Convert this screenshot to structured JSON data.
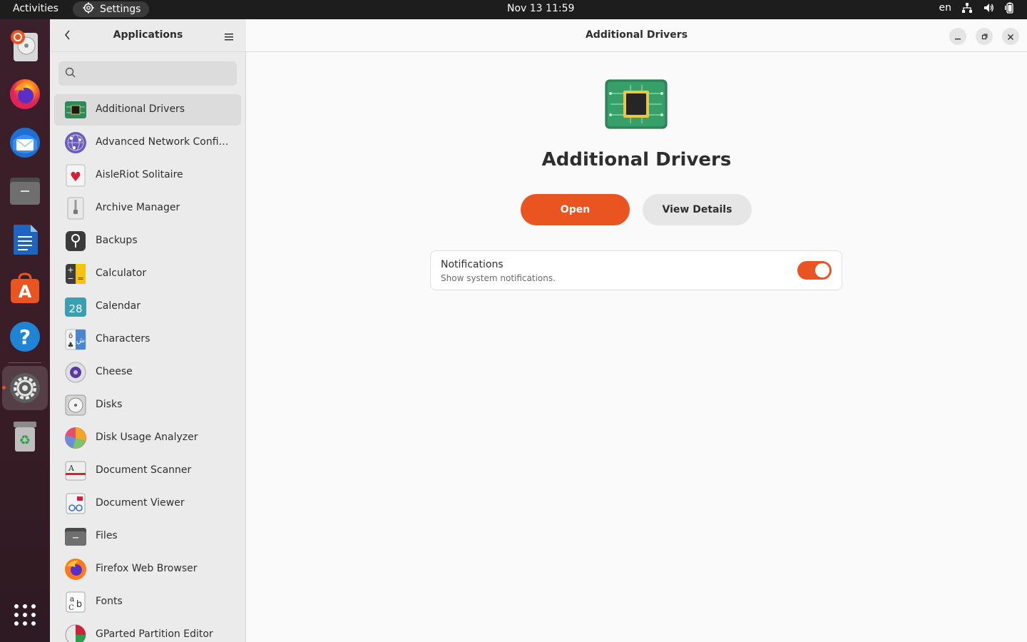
{
  "topbar": {
    "activities": "Activities",
    "app_name": "Settings",
    "clock": "Nov 13  11:59",
    "lang": "en"
  },
  "dock": {
    "items": [
      "ubuntu-installer-icon",
      "firefox-icon",
      "thunderbird-icon",
      "files-icon",
      "libreoffice-writer-icon",
      "app-center-icon",
      "help-icon",
      "settings-icon",
      "trash-icon",
      "show-apps-icon"
    ]
  },
  "sidebar": {
    "title": "Applications",
    "search_placeholder": "",
    "apps": [
      {
        "label": "Additional Drivers",
        "icon": "chip-icon",
        "selected": true
      },
      {
        "label": "Advanced Network Configuration",
        "icon": "network-globe-icon"
      },
      {
        "label": "AisleRiot Solitaire",
        "icon": "cards-icon"
      },
      {
        "label": "Archive Manager",
        "icon": "archive-icon"
      },
      {
        "label": "Backups",
        "icon": "backups-icon"
      },
      {
        "label": "Calculator",
        "icon": "calculator-icon"
      },
      {
        "label": "Calendar",
        "icon": "calendar-icon"
      },
      {
        "label": "Characters",
        "icon": "characters-icon"
      },
      {
        "label": "Cheese",
        "icon": "cheese-icon"
      },
      {
        "label": "Disks",
        "icon": "disks-icon"
      },
      {
        "label": "Disk Usage Analyzer",
        "icon": "disk-usage-icon"
      },
      {
        "label": "Document Scanner",
        "icon": "scanner-icon"
      },
      {
        "label": "Document Viewer",
        "icon": "document-viewer-icon"
      },
      {
        "label": "Files",
        "icon": "files-icon"
      },
      {
        "label": "Firefox Web Browser",
        "icon": "firefox-icon"
      },
      {
        "label": "Fonts",
        "icon": "fonts-icon"
      },
      {
        "label": "GParted Partition Editor",
        "icon": "gparted-icon"
      }
    ]
  },
  "main": {
    "header_title": "Additional Drivers",
    "app_name": "Additional Drivers",
    "open_label": "Open",
    "details_label": "View Details",
    "notifications": {
      "title": "Notifications",
      "subtitle": "Show system notifications.",
      "enabled": true
    }
  },
  "colors": {
    "accent": "#e95420",
    "topbar": "#1d1d1d",
    "sidebar_bg": "#ebebeb",
    "content_bg": "#fafafa"
  }
}
